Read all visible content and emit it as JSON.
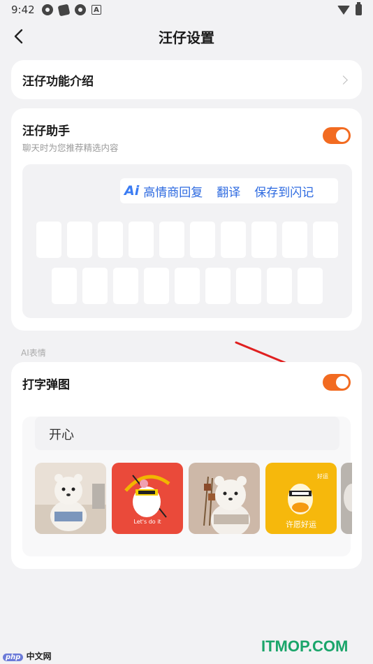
{
  "status_bar": {
    "time": "9:42",
    "badge_letter": "A"
  },
  "header": {
    "title": "汪仔设置"
  },
  "intro_row": {
    "label": "汪仔功能介绍"
  },
  "assistant": {
    "title": "汪仔助手",
    "subtitle": "聊天时为您推荐精选内容",
    "enabled": true,
    "preview": {
      "ai_badge": "Ai",
      "suggestions": [
        "高情商回复",
        "翻译",
        "保存到闪记"
      ]
    }
  },
  "ai_expression": {
    "section_label": "AI表情",
    "title": "打字弹图",
    "enabled": true,
    "mood_text": "开心",
    "stickers": [
      {
        "name": "bear-office",
        "color": "#e8ded4"
      },
      {
        "name": "cartoon-red",
        "color": "#ea4a3a",
        "caption": "Let's do it"
      },
      {
        "name": "bear-skewers",
        "color": "#cdb8a8"
      },
      {
        "name": "cartoon-yellow",
        "color": "#f6b80c",
        "caption": "许愿好运",
        "small_text": "好运"
      },
      {
        "name": "bear-partial",
        "color": "#b9b4ae"
      }
    ]
  },
  "watermarks": {
    "left": "中文网",
    "left_logo": "php",
    "right": "ITMOP.COM"
  },
  "colors": {
    "accent": "#f26b21",
    "link": "#2d6ae0"
  }
}
